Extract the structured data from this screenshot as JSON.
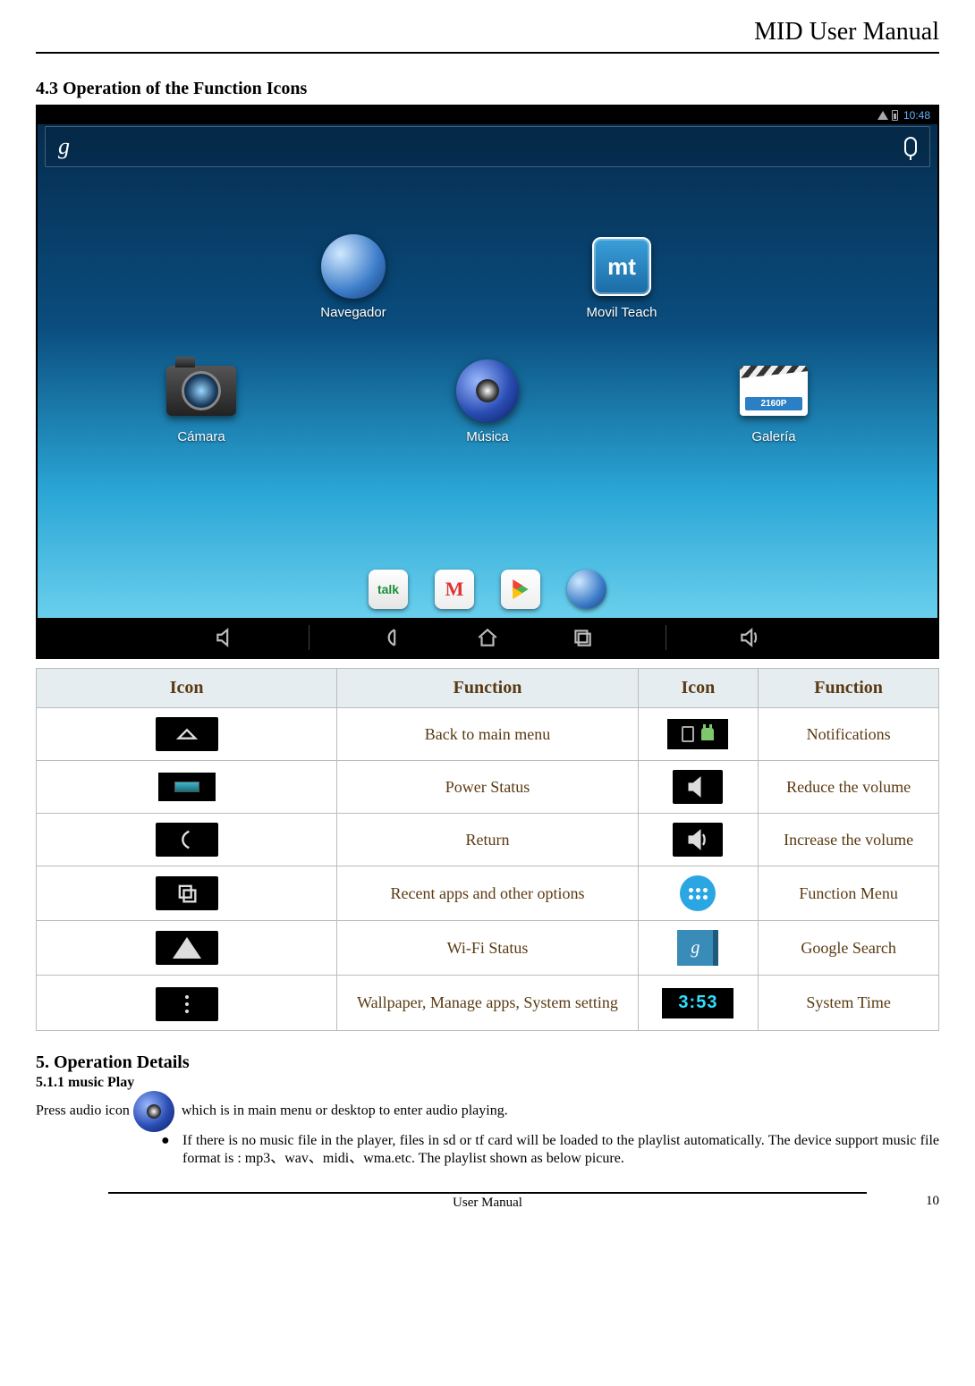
{
  "header": {
    "title": "MID User Manual"
  },
  "section43": {
    "heading": "4.3 Operation of the Function Icons"
  },
  "screenshot": {
    "status_time": "10:48",
    "apps": {
      "navegador": "Navegador",
      "movil_teach": "Movil Teach",
      "camara": "Cámara",
      "musica": "Música",
      "galeria": "Galería",
      "gallery_tag": "2160P",
      "mt_text": "mt",
      "talk_text": "talk",
      "gmail_text": "M"
    }
  },
  "table": {
    "headers": {
      "icon": "Icon",
      "function": "Function",
      "icon2": "Icon",
      "function2": "Function"
    },
    "rows": [
      {
        "f1": "Back to main menu",
        "f2": "Notifications"
      },
      {
        "f1": "Power Status",
        "f2": "Reduce the volume"
      },
      {
        "f1": "Return",
        "f2": "Increase the volume"
      },
      {
        "f1": "Recent apps and other options",
        "f2": "Function Menu"
      },
      {
        "f1": "Wi-Fi Status",
        "f2": "Google Search"
      },
      {
        "f1": "Wallpaper, Manage apps, System setting",
        "f2": "System Time"
      }
    ],
    "time_sample": "3:53",
    "g_letter": "g"
  },
  "section5": {
    "heading": "5. Operation Details",
    "sub": "5.1.1 music Play",
    "line_pre": "Press audio icon",
    "line_post": " which is in main menu or desktop to enter audio playing.",
    "bullet": "If there is no music file in the player, files in sd or tf card will be loaded to the playlist automatically. The device support music file format is : mp3、wav、midi、wma.etc. The playlist shown as below picure."
  },
  "footer": {
    "center": "User Manual",
    "page": "10"
  }
}
